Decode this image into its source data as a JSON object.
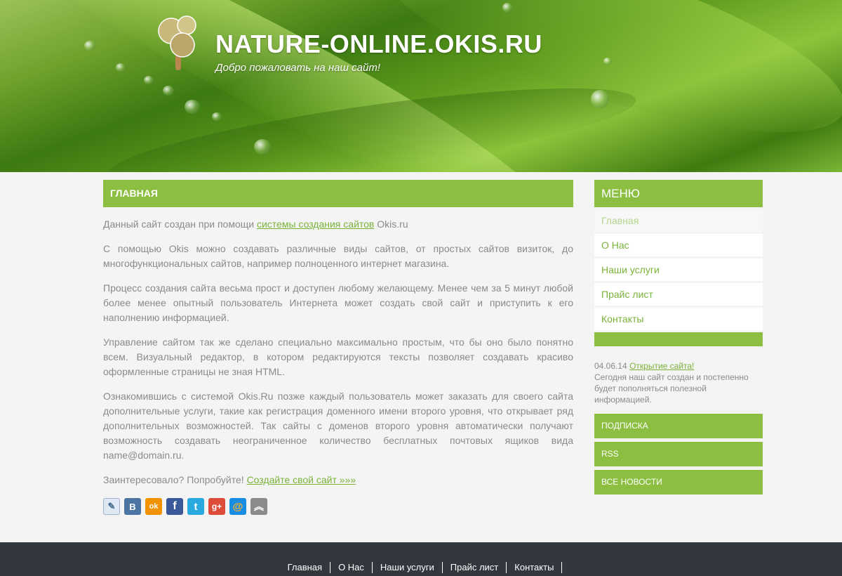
{
  "header": {
    "site_title": "NATURE-ONLINE.OKIS.RU",
    "slogan": "Добро пожаловать на наш сайт!"
  },
  "content": {
    "title": "ГЛАВНАЯ",
    "p1_before": "Данный сайт создан при помощи ",
    "p1_link": "системы создания сайтов",
    "p1_after": " Okis.ru",
    "p2": "С помощью Okis можно создавать различные виды сайтов, от простых сайтов визиток, до многофункциональных сайтов, например полноценного интернет магазина.",
    "p3": "Процесс создания сайта весьма прост и доступен любому желающему. Менее чем за 5 минут любой более менее опытный пользователь Интернета может создать свой сайт и приступить к его наполнению информацией.",
    "p4": "Управление сайтом так же сделано специально максимально простым, что бы оно было понятно всем. Визуальный редактор, в котором редактируются тексты позволяет создавать красиво оформленные страницы не зная HTML.",
    "p5": "Ознакомившись с системой Okis.Ru позже каждый пользователь может заказать для своего сайта дополнительные услуги, такие как регистрация доменного имени второго уровня, что открывает ряд дополнительных возможностей. Так сайты с доменов второго уровня автоматически получают возможность создавать неограниченное количество бесплатных почтовых ящиков вида name@domain.ru.",
    "p6_before": "Заинтересовало? Попробуйте! ",
    "p6_link": "Создайте свой сайт »»»",
    "share_icons": [
      {
        "name": "livejournal-icon",
        "glyph": "✎",
        "color": "#dfe9f4"
      },
      {
        "name": "vkontakte-icon",
        "glyph": "B",
        "color": "#4c75a3"
      },
      {
        "name": "odnoklassniki-icon",
        "glyph": "ok",
        "color": "#f29200"
      },
      {
        "name": "facebook-icon",
        "glyph": "f",
        "color": "#3b5998"
      },
      {
        "name": "twitter-icon",
        "glyph": "t",
        "color": "#2aa9e0"
      },
      {
        "name": "google-plus-icon",
        "glyph": "g+",
        "color": "#dd4b39"
      },
      {
        "name": "mailru-icon",
        "glyph": "@",
        "color": "#168de2"
      },
      {
        "name": "more-share-icon",
        "glyph": "︽",
        "color": "#8b8b8b"
      }
    ]
  },
  "sidebar": {
    "menu_title": "МЕНЮ",
    "menu_items": [
      "Главная",
      "О Нас",
      "Наши услуги",
      "Прайс лист",
      "Контакты"
    ],
    "news": {
      "date": "04.06.14",
      "link": "Открытие сайта!",
      "text": "Сегодня наш сайт создан и постепенно будет пополняться полезной информацией."
    },
    "buttons": [
      "ПОДПИСКА",
      "RSS",
      "ВСЕ НОВОСТИ"
    ]
  },
  "footer": {
    "nav": [
      "Главная",
      "О Нас",
      "Наши услуги",
      "Прайс лист",
      "Контакты"
    ]
  },
  "colors": {
    "accent": "#8cbf41",
    "link": "#7ab33a",
    "footer_bg": "#32363d"
  }
}
